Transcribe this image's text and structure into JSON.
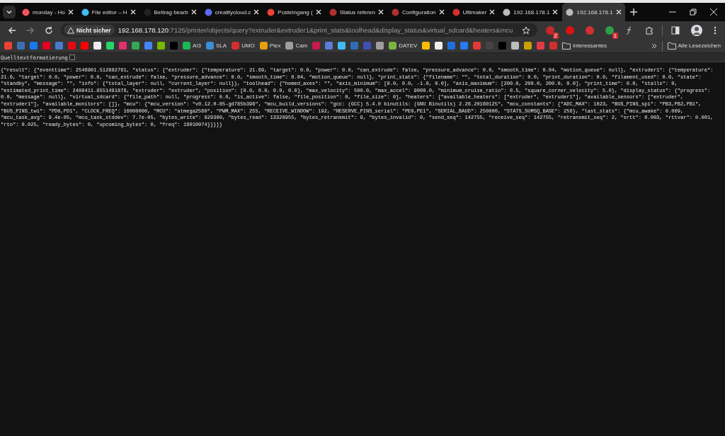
{
  "tabs": [
    {
      "title": "monday - Ho",
      "selected": false,
      "color": "#f2545b"
    },
    {
      "title": "File editor – H",
      "selected": false,
      "color": "#41bdf5"
    },
    {
      "title": "Beitrag bearb",
      "selected": false,
      "color": "#222222"
    },
    {
      "title": "crealitycloud.c",
      "selected": false,
      "color": "#5b6cf0"
    },
    {
      "title": "Posteingang (",
      "selected": false,
      "color": "#ea4335"
    },
    {
      "title": "Status referen",
      "selected": false,
      "color": "#b03030"
    },
    {
      "title": "Configuration",
      "selected": false,
      "color": "#b03030"
    },
    {
      "title": "Ultimaker",
      "selected": false,
      "color": "#d32f2f"
    },
    {
      "title": "192.168.178.1",
      "selected": false,
      "color": "#bbbbbb"
    },
    {
      "title": "192.168.178.1",
      "selected": true,
      "color": "#bbbbbb"
    }
  ],
  "address": {
    "security": "Nicht sicher",
    "host": "192.168.178.120",
    "path": ":7125/printer/objects/query?extruder&extruder1&print_stats&toolhead&display_status&virtual_sdcard&heaters&mcu"
  },
  "extensions": [
    {
      "badge": "2",
      "color": "#c62828"
    },
    {
      "color": "#e01010"
    },
    {
      "color": "#d32f2f"
    },
    {
      "badge": "1",
      "color": "#2e9e4a"
    }
  ],
  "bookmarks": [
    {
      "color": "#ea4335"
    },
    {
      "color": "#3a6fb5"
    },
    {
      "color": "#1877f2"
    },
    {
      "color": "#e60023"
    },
    {
      "color": "#4a7bd0"
    },
    {
      "color": "#e50914"
    },
    {
      "color": "#ff0000"
    },
    {
      "color": "#eeeeee"
    },
    {
      "color": "#25d366"
    },
    {
      "color": "#e1306c"
    },
    {
      "color": "#34a853"
    },
    {
      "color": "#4285f4"
    },
    {
      "color": "#76b900"
    },
    {
      "color": "#000000"
    },
    {
      "label": "AI3",
      "color": "#1db954"
    },
    {
      "label": "SLA",
      "color": "#3a8fd8"
    },
    {
      "label": "UMO",
      "color": "#d32f2f"
    },
    {
      "label": "Plex",
      "color": "#e5a00d"
    },
    {
      "label": "Cam",
      "color": "#9e9e9e"
    },
    {
      "color": "#c51a4a"
    },
    {
      "color": "#5a7dd8"
    },
    {
      "color": "#41bdf5"
    },
    {
      "color": "#2f6db5"
    },
    {
      "color": "#3f51b5"
    },
    {
      "color": "#9e9e9e"
    },
    {
      "label": "DATEV",
      "color": "#7cb342"
    },
    {
      "color": "#fbbc05"
    },
    {
      "color": "#eeeeee"
    },
    {
      "color": "#1e6fe0"
    },
    {
      "color": "#2a7af0"
    },
    {
      "color": "#e53935"
    },
    {
      "color": "#444444"
    },
    {
      "color": "#000000"
    },
    {
      "color": "#bdbdbd"
    },
    {
      "color": "#c8a000"
    },
    {
      "color": "#e53945"
    },
    {
      "color": "#d32f2f"
    }
  ],
  "bookmark_folder": "interessantes",
  "all_bookmarks": "Alle Lesezeichen",
  "format_toggle": {
    "label": "Quelltextformatierung",
    "checked": false
  },
  "json_lines": [
    "{\"result\": {\"eventtime\": 2546901.512882761, \"status\": {\"extruder\": {\"temperature\": 21.69, \"target\": 0.0, \"power\": 0.0, \"can_extrude\": false, \"pressure_advance\": 0.0, \"smooth_time\": 0.04, \"motion_queue\": null}, \"extruder1\": {\"temperature\":",
    "21.6, \"target\": 0.0, \"power\": 0.0, \"can_extrude\": false, \"pressure_advance\": 0.0, \"smooth_time\": 0.04, \"motion_queue\": null}, \"print_stats\": {\"filename\": \"\", \"total_duration\": 0.0, \"print_duration\": 0.0, \"filament_used\": 0.0, \"state\":",
    "\"standby\", \"message\": \"\", \"info\": {\"total_layer\": null, \"current_layer\": null}}, \"toolhead\": {\"homed_axes\": \"\", \"axis_minimum\": [0.0, 0.0, -1.0, 0.0], \"axis_maximum\": [200.0, 200.0, 200.0, 0.0], \"print_time\": 0.0, \"stalls\": 0,",
    "\"estimated_print_time\": 2408411.8551491876, \"extruder\": \"extruder\", \"position\": [0.0, 0.0, 0.0, 0.0], \"max_velocity\": 500.0, \"max_accel\": 9000.0, \"minimum_cruise_ratio\": 0.5, \"square_corner_velocity\": 5.0}, \"display_status\": {\"progress\":",
    "0.0, \"message\": null}, \"virtual_sdcard\": {\"file_path\": null, \"progress\": 0.0, \"is_active\": false, \"file_position\": 0, \"file_size\": 0}, \"heaters\": {\"available_heaters\": [\"extruder\", \"extruder1\"], \"available_sensors\": [\"extruder\",",
    "\"extruder1\"], \"available_monitors\": []}, \"mcu\": {\"mcu_version\": \"v0.12.0-85-gd785b396\", \"mcu_build_versions\": \"gcc: (GCC) 5.4.0 binutils: (GNU Binutils) 2.26.20160125\", \"mcu_constants\": {\"ADC_MAX\": 1023, \"BUS_PINS_spi\": \"PB3,PB2,PB1\",",
    "\"BUS_PINS_twi\": \"PD0,PD1\", \"CLOCK_FREQ\": 16000000, \"MCU\": \"atmega2560\", \"PWM_MAX\": 255, \"RECEIVE_WINDOW\": 192, \"RESERVE_PINS_serial\": \"PE0,PE1\", \"SERIAL_BAUD\": 250000, \"STATS_SUMSQ_BASE\": 256}, \"last_stats\": {\"mcu_awake\": 0.009,",
    "\"mcu_task_avg\": 9.4e-05, \"mcu_task_stddev\": 7.7e-05, \"bytes_write\": 929300, \"bytes_read\": 13328955, \"bytes_retransmit\": 9, \"bytes_invalid\": 0, \"send_seq\": 142755, \"receive_seq\": 142755, \"retransmit_seq\": 2, \"srtt\": 0.003, \"rttvar\": 0.001,",
    "\"rto\": 0.025, \"ready_bytes\": 0, \"upcoming_bytes\": 0, \"freq\": 16010074}}}}}"
  ]
}
